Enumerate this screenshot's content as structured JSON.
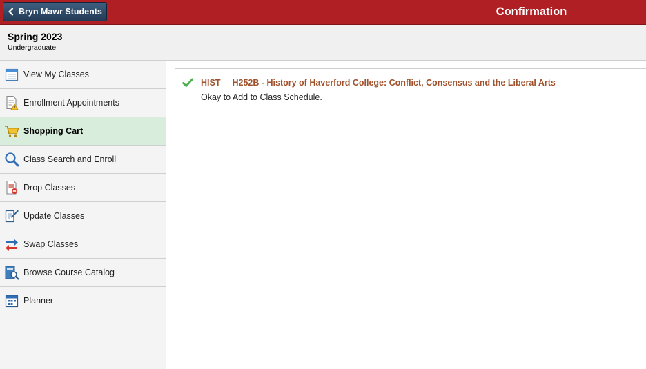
{
  "header": {
    "back_label": "Bryn Mawr Students",
    "page_title": "Confirmation"
  },
  "term": {
    "title": "Spring 2023",
    "career": "Undergraduate"
  },
  "sidebar": {
    "items": [
      {
        "label": "View My Classes",
        "icon": "calendar-icon",
        "active": false
      },
      {
        "label": "Enrollment Appointments",
        "icon": "document-warning-icon",
        "active": false
      },
      {
        "label": "Shopping Cart",
        "icon": "shopping-cart-icon",
        "active": true
      },
      {
        "label": "Class Search and Enroll",
        "icon": "search-icon",
        "active": false
      },
      {
        "label": "Drop Classes",
        "icon": "drop-document-icon",
        "active": false
      },
      {
        "label": "Update Classes",
        "icon": "edit-document-icon",
        "active": false
      },
      {
        "label": "Swap Classes",
        "icon": "swap-arrows-icon",
        "active": false
      },
      {
        "label": "Browse Course Catalog",
        "icon": "catalog-search-icon",
        "active": false
      },
      {
        "label": "Planner",
        "icon": "planner-icon",
        "active": false
      }
    ]
  },
  "confirmation": {
    "status_icon": "checkmark-icon",
    "subject": "HIST",
    "course": "H252B - History of Haverford College: Conflict, Consensus and the Liberal Arts",
    "message": "Okay to Add to Class Schedule."
  },
  "colors": {
    "header_red": "#b01f24",
    "back_button": "#2e4a6a",
    "active_item": "#d8eddb",
    "course_link": "#a0522d",
    "success_green": "#4caf50"
  }
}
